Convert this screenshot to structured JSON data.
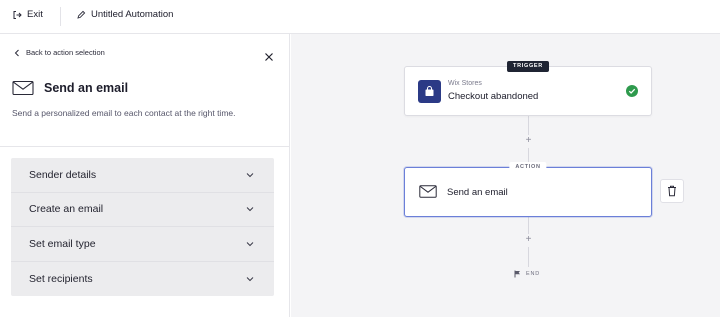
{
  "topbar": {
    "exit_label": "Exit",
    "title": "Untitled Automation"
  },
  "panel": {
    "back_label": "Back to action selection",
    "title": "Send an email",
    "description": "Send a personalized email to each contact at the right time.",
    "sections": [
      {
        "label": "Sender details"
      },
      {
        "label": "Create an email"
      },
      {
        "label": "Set email type"
      },
      {
        "label": "Set recipients"
      }
    ]
  },
  "canvas": {
    "trigger": {
      "tag": "TRIGGER",
      "app": "Wix Stores",
      "event": "Checkout abandoned"
    },
    "action": {
      "tag": "ACTION",
      "label": "Send an email"
    },
    "end_label": "END",
    "add_symbol": "+"
  },
  "colors": {
    "accent_border": "#6b7fd8",
    "success": "#2e9a4d",
    "wix_stores": "#2b3a86",
    "canvas_bg": "#f4f4f6"
  },
  "icons": [
    "exit-icon",
    "pencil-icon",
    "chevron-left-icon",
    "close-icon",
    "envelope-icon",
    "chevron-down-icon",
    "wix-stores-icon",
    "check-circle-icon",
    "trash-icon",
    "flag-icon"
  ]
}
